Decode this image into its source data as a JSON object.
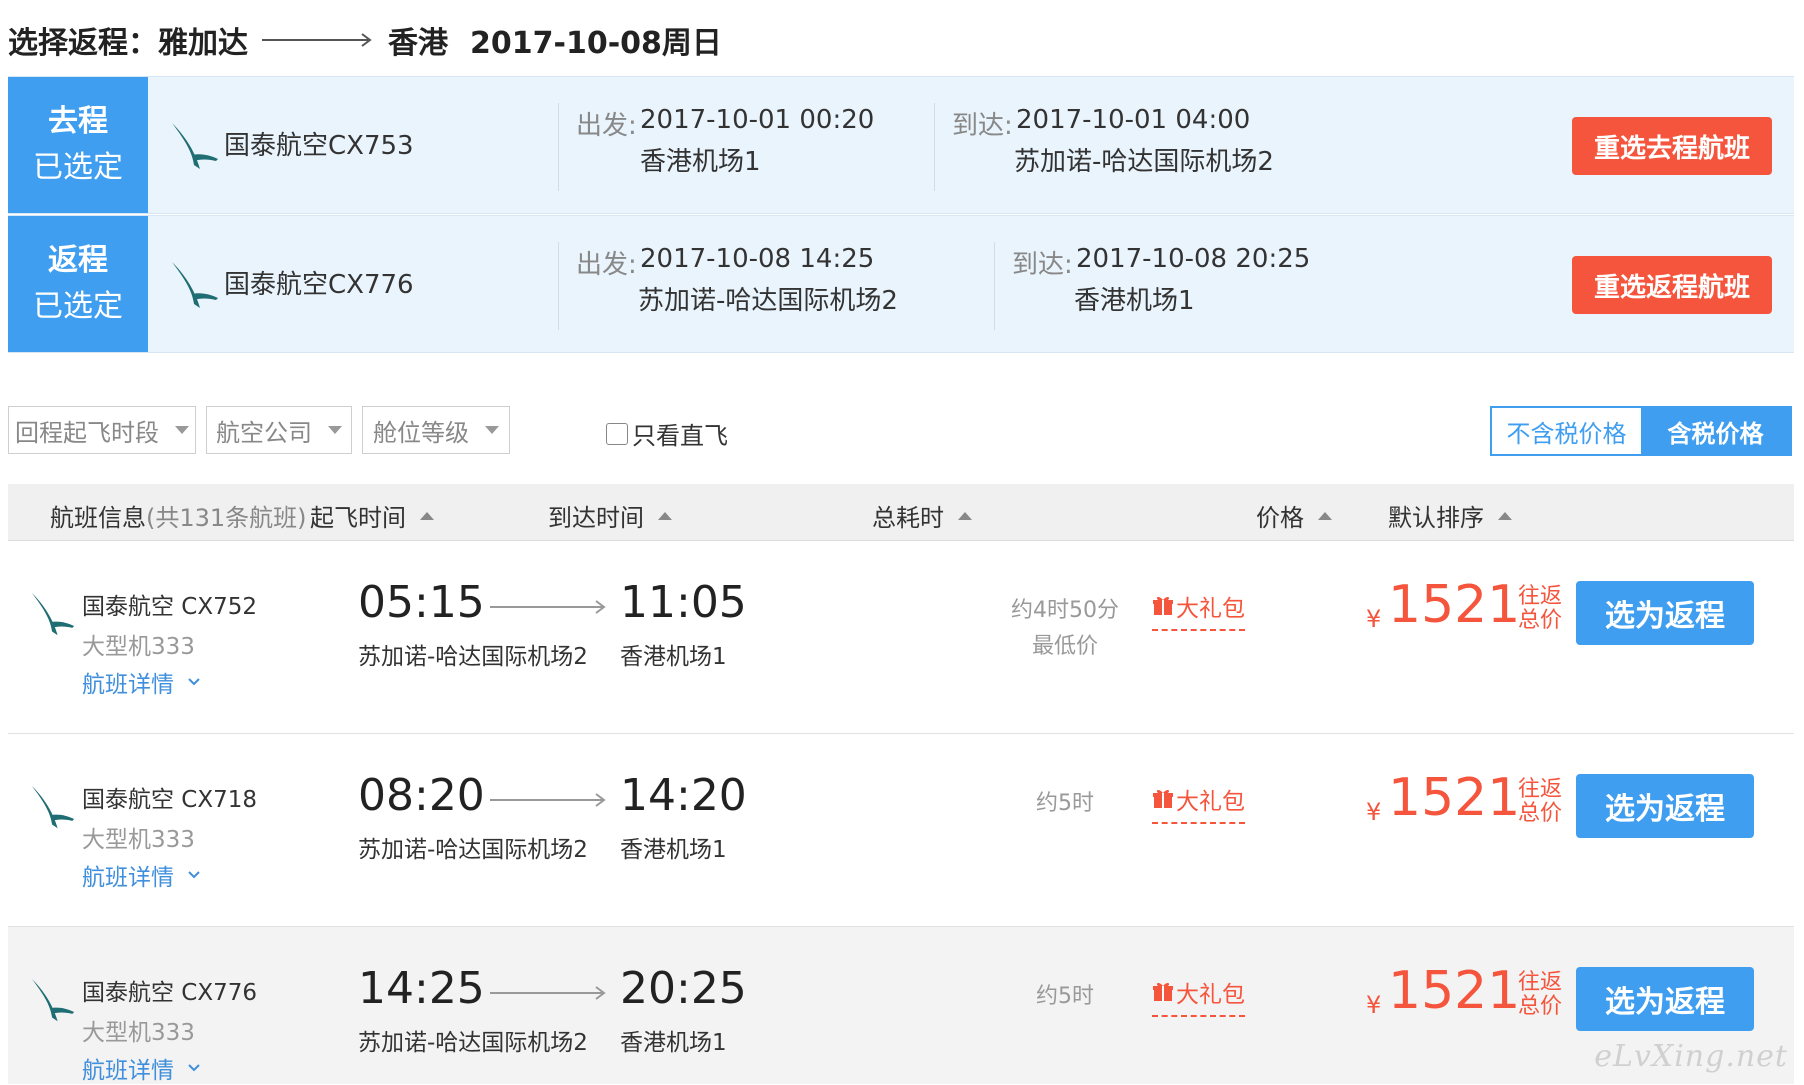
{
  "header": {
    "prefix": "选择返程：",
    "from": "雅加达",
    "to": "香港",
    "date": "2017-10-08周日"
  },
  "outbound": {
    "badge_line1": "去程",
    "badge_line2": "已选定",
    "flight": "国泰航空CX753",
    "dep_label": "出发:",
    "dep_time": "2017-10-01 00:20",
    "dep_airport": "香港机场1",
    "arr_label": "到达:",
    "arr_time": "2017-10-01 04:00",
    "arr_airport": "苏加诺-哈达国际机场2",
    "button": "重选去程航班"
  },
  "return": {
    "badge_line1": "返程",
    "badge_line2": "已选定",
    "flight": "国泰航空CX776",
    "dep_label": "出发:",
    "dep_time": "2017-10-08 14:25",
    "dep_airport": "苏加诺-哈达国际机场2",
    "arr_label": "到达:",
    "arr_time": "2017-10-08 20:25",
    "arr_airport": "香港机场1",
    "button": "重选返程航班"
  },
  "filters": {
    "time": "回程起飞时段",
    "airline": "航空公司",
    "cabin": "舱位等级",
    "direct": "只看直飞",
    "direct_checked": false
  },
  "price_toggle": {
    "exclude": "不含税价格",
    "include": "含税价格",
    "active": "include"
  },
  "table_header": {
    "info": "航班信息",
    "info_count": "(共131条航班)",
    "dep": "起飞时间",
    "arr": "到达时间",
    "duration": "总耗时",
    "price": "价格",
    "sort": "默认排序"
  },
  "flights": [
    {
      "airline": "国泰航空 CX752",
      "plane": "大型机333",
      "details": "航班详情",
      "dep_time": "05:15",
      "dep_airport": "苏加诺-哈达国际机场2",
      "arr_time": "11:05",
      "arr_airport": "香港机场1",
      "duration": "约4时50分",
      "note": "最低价",
      "gift": "大礼包",
      "currency": "¥",
      "price": "1521",
      "price_note1": "往返",
      "price_note2": "总价",
      "button": "选为返程"
    },
    {
      "airline": "国泰航空 CX718",
      "plane": "大型机333",
      "details": "航班详情",
      "dep_time": "08:20",
      "dep_airport": "苏加诺-哈达国际机场2",
      "arr_time": "14:20",
      "arr_airport": "香港机场1",
      "duration": "约5时",
      "note": "",
      "gift": "大礼包",
      "currency": "¥",
      "price": "1521",
      "price_note1": "往返",
      "price_note2": "总价",
      "button": "选为返程"
    },
    {
      "airline": "国泰航空 CX776",
      "plane": "大型机333",
      "details": "航班详情",
      "dep_time": "14:25",
      "dep_airport": "苏加诺-哈达国际机场2",
      "arr_time": "20:25",
      "arr_airport": "香港机场1",
      "duration": "约5时",
      "note": "",
      "gift": "大礼包",
      "currency": "¥",
      "price": "1521",
      "price_note1": "往返",
      "price_note2": "总价",
      "button": "选为返程"
    }
  ],
  "watermark": "eLvXing.net",
  "colors": {
    "primary": "#3f9ef0",
    "accent": "#f5553c",
    "card_bg": "#eaf4fd"
  }
}
